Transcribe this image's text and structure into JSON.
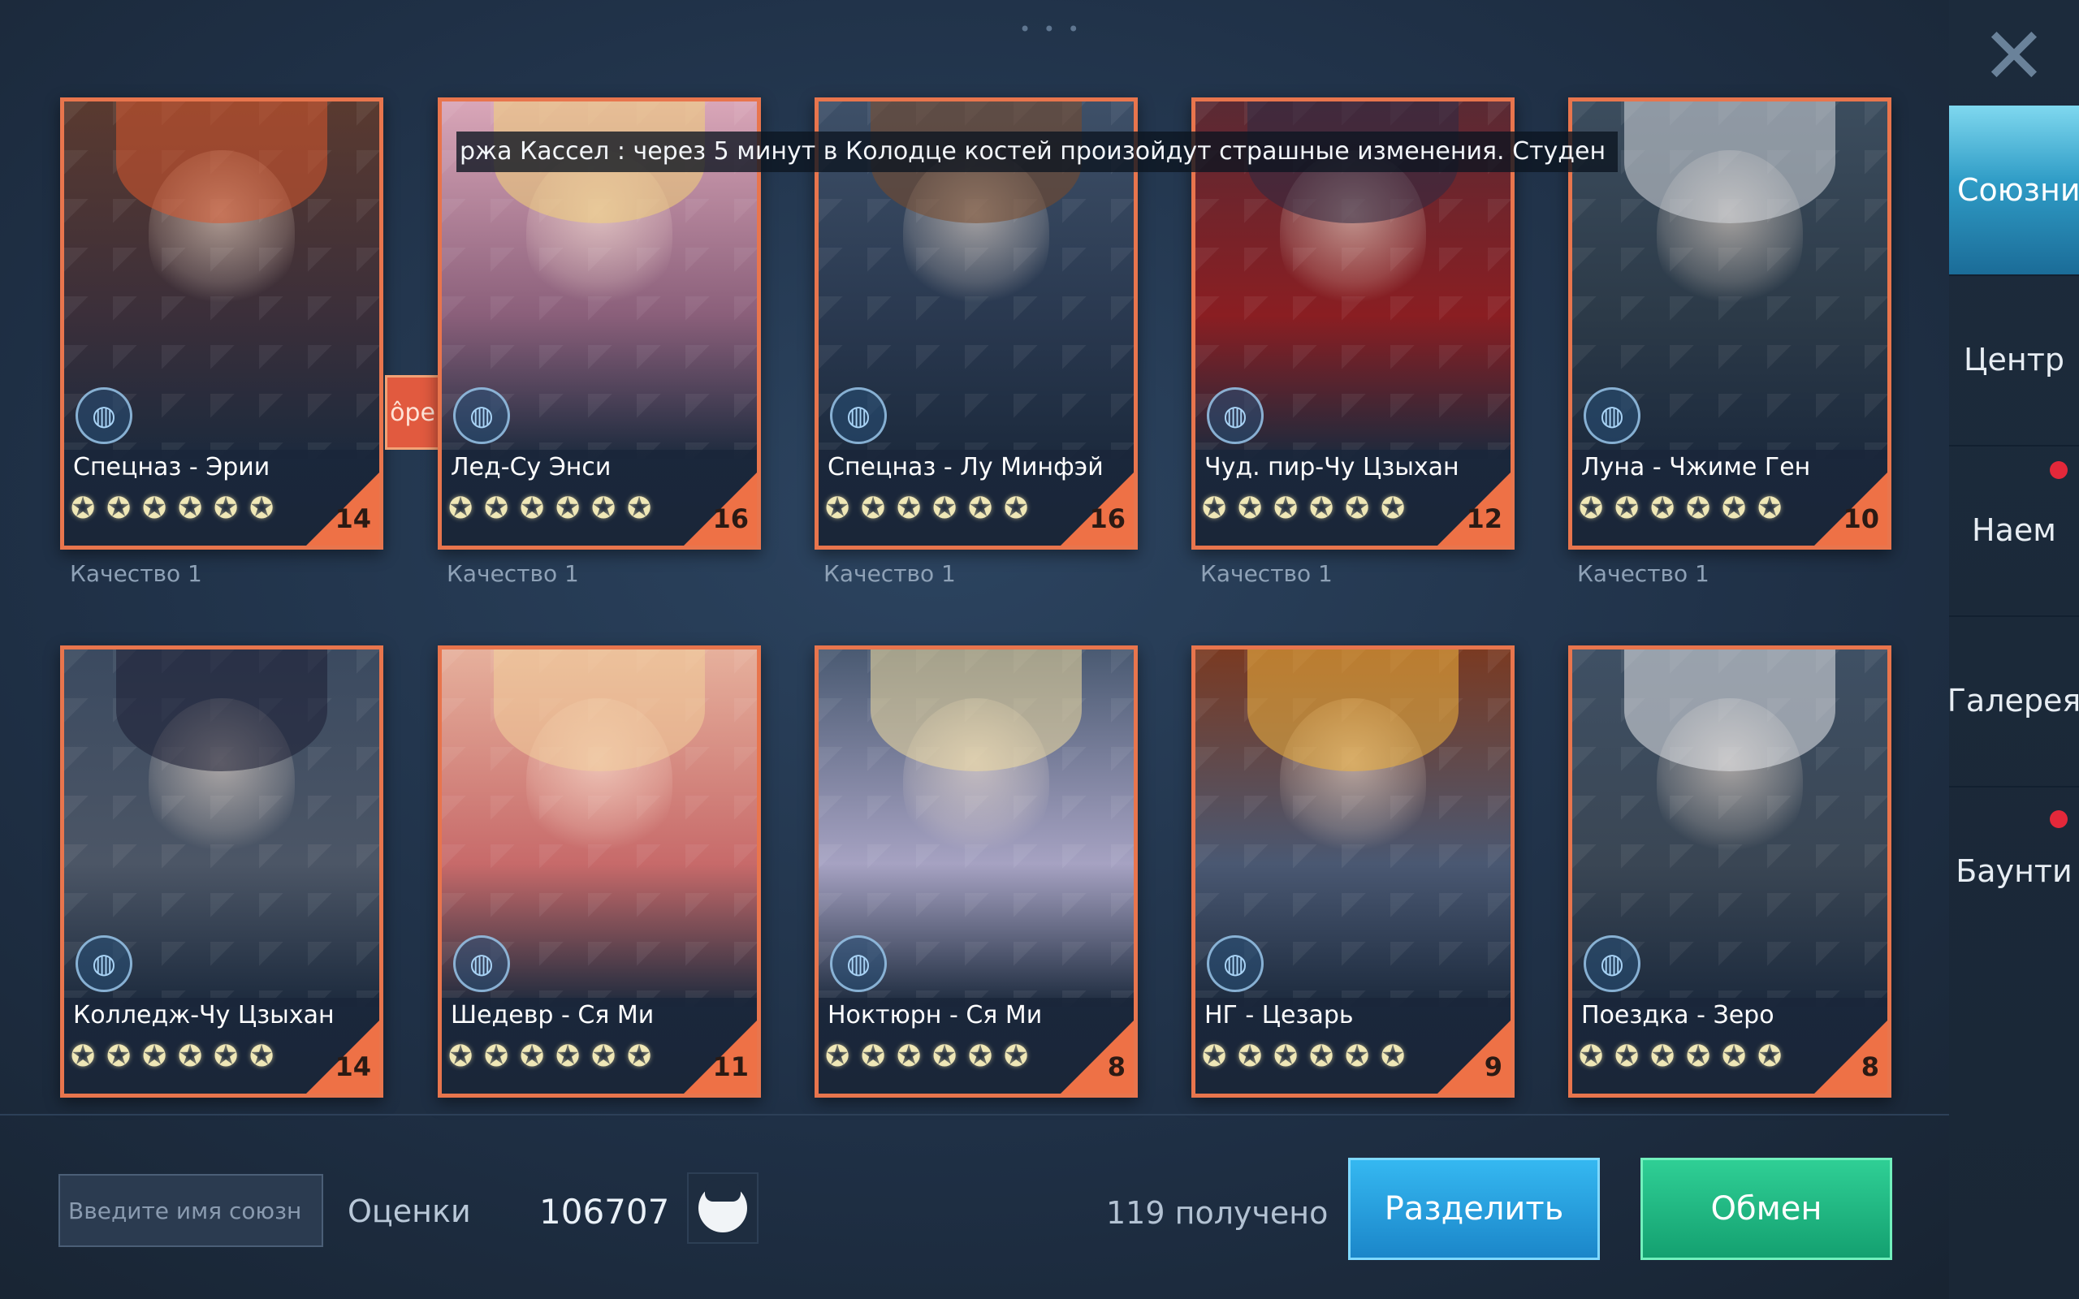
{
  "grip": "• • •",
  "marquee": "ржа Кассел : через 5 минут в Колодце костей произойдут страшные изменения. Студен",
  "tag_label": "ôpe",
  "close_glyph": "✕",
  "cards": [
    {
      "name": "Спецназ - Эрии",
      "level": "14",
      "quality": "Качество 1"
    },
    {
      "name": "Лед-Су Энси",
      "level": "16",
      "quality": "Качество 1"
    },
    {
      "name": "Спецназ - Лу Минфэй",
      "level": "16",
      "quality": "Качество 1"
    },
    {
      "name": "Чуд. пир-Чу Цзыхан",
      "level": "12",
      "quality": "Качество 1"
    },
    {
      "name": "Луна - Чжиме Ген",
      "level": "10",
      "quality": "Качество 1"
    },
    {
      "name": "Колледж-Чу Цзыхан",
      "level": "14"
    },
    {
      "name": "Шедевр - Ся Ми",
      "level": "11"
    },
    {
      "name": "Ноктюрн - Ся Ми",
      "level": "8"
    },
    {
      "name": "НГ - Цезарь",
      "level": "9"
    },
    {
      "name": "Поездка - Зеро",
      "level": "8"
    }
  ],
  "stars_per_card": 6,
  "sidebar": {
    "items": [
      {
        "label": "Союзник",
        "active": true
      },
      {
        "label": "Центр"
      },
      {
        "label": "Наем",
        "notification": true
      },
      {
        "label": "Галерея"
      },
      {
        "label": "Баунти",
        "notification": true
      }
    ]
  },
  "bottom": {
    "search_placeholder": "Введите имя союзн",
    "ratings_label": "Оценки",
    "score": "106707",
    "received": "119 получено",
    "split_button": "Разделить",
    "swap_button": "Обмен"
  },
  "colors": {
    "card_border": "#e8754d",
    "accent_blue": "#2f9cc6",
    "accent_green": "#14a070",
    "notification": "#e3283a"
  }
}
